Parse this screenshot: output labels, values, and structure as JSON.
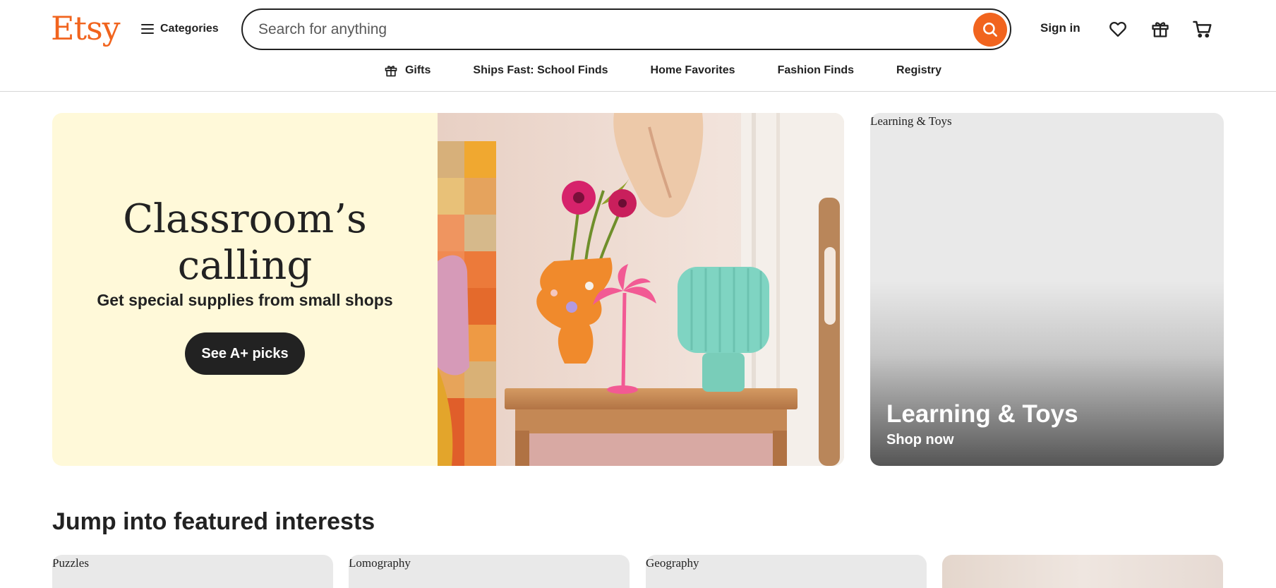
{
  "header": {
    "logo": "Etsy",
    "categories_label": "Categories",
    "search_placeholder": "Search for anything",
    "sign_in": "Sign in"
  },
  "subnav": {
    "items": [
      "Gifts",
      "Ships Fast: School Finds",
      "Home Favorites",
      "Fashion Finds",
      "Registry"
    ]
  },
  "hero": {
    "title_line1": "Classroom’s",
    "title_line2": "calling",
    "subtitle": "Get special supplies from small shops",
    "button": "See A+ picks"
  },
  "side_card": {
    "image_alt": "Learning & Toys",
    "title": "Learning & Toys",
    "cta": "Shop now"
  },
  "featured": {
    "title": "Jump into featured interests",
    "tiles": [
      "Puzzles",
      "Lomography",
      "Geography",
      ""
    ]
  },
  "colors": {
    "brand": "#f1641e",
    "hero_bg": "#fff9d9",
    "dark": "#222222"
  },
  "icons": {
    "menu": "hamburger-icon",
    "search": "search-icon",
    "favorites": "heart-icon",
    "gift": "gift-icon",
    "cart": "cart-icon"
  }
}
